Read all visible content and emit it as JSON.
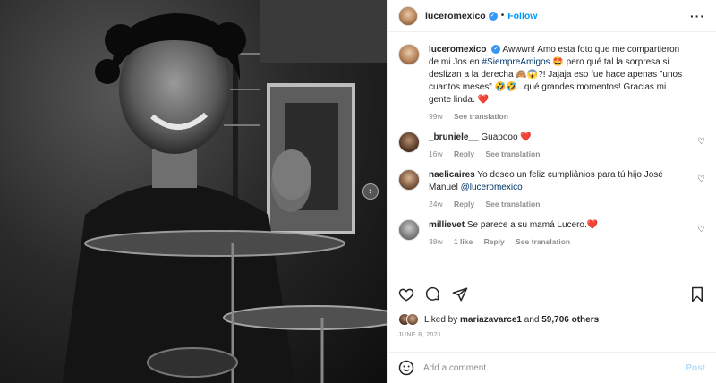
{
  "post": {
    "username": "luceromexico",
    "follow_label": "Follow",
    "caption_prefix": "Awwwn! Amo esta foto que me compartieron de mi Jos en ",
    "caption_hashtag": "#SiempreAmigos",
    "caption_rest": " 🤩 pero qué tal la sorpresa si deslizan a la derecha 🙈😱?! Jajaja eso fue hace apenas \"unos cuantos meses\" 🤣🤣...qué grandes momentos! Gracias mi gente linda. ❤️",
    "caption_time": "99w",
    "see_translation": "See translation"
  },
  "comments": [
    {
      "username": "_bruniele__",
      "text": "Guapooo ❤️",
      "mention": "",
      "time": "16w",
      "reply": "Reply",
      "likes": "",
      "translate": "See translation"
    },
    {
      "username": "naelicaires",
      "text": "Yo deseo un feliz cumpliânios para tú hijo José Manuel ",
      "mention": "@luceromexico",
      "time": "24w",
      "reply": "Reply",
      "likes": "",
      "translate": "See translation"
    },
    {
      "username": "millievet",
      "text": "Se parece a su mamá Lucero.❤️",
      "mention": "",
      "time": "38w",
      "reply": "Reply",
      "likes": "1 like",
      "translate": "See translation"
    }
  ],
  "likes": {
    "prefix": "Liked by ",
    "user": "mariazavarce1",
    "middle": " and ",
    "others": "59,706 others"
  },
  "date": "JUNE 8, 2021",
  "add_comment": {
    "placeholder": "Add a comment...",
    "post_label": "Post"
  },
  "colors": {
    "accent": "#0095f6",
    "link": "#00376b",
    "heart": "#ed4956",
    "muted": "#8e8e8e"
  },
  "icons": [
    "heart-icon",
    "comment-icon",
    "share-icon",
    "bookmark-icon",
    "emoji-icon",
    "more-icon",
    "verified-icon",
    "chevron-left-icon"
  ]
}
